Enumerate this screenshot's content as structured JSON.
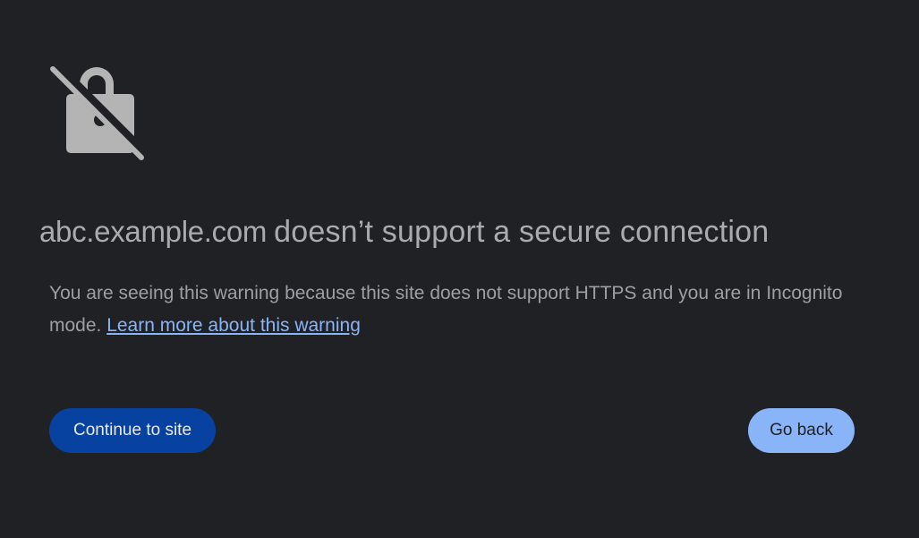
{
  "icon": "insecure-lock-icon",
  "heading": {
    "host": "abc.example.com",
    "message": "doesn’t support a secure connection"
  },
  "explanation": {
    "text": "You are seeing this warning because this site does not support HTTPS and you are in Incognito mode. ",
    "link_label": "Learn more about this warning"
  },
  "buttons": {
    "continue_label": "Continue to site",
    "back_label": "Go back"
  },
  "colors": {
    "background": "#202124",
    "primary_button": "#0842a0",
    "secondary_button": "#8ab4f8",
    "link": "#8ab4f8",
    "text": "#9aa0a6"
  }
}
